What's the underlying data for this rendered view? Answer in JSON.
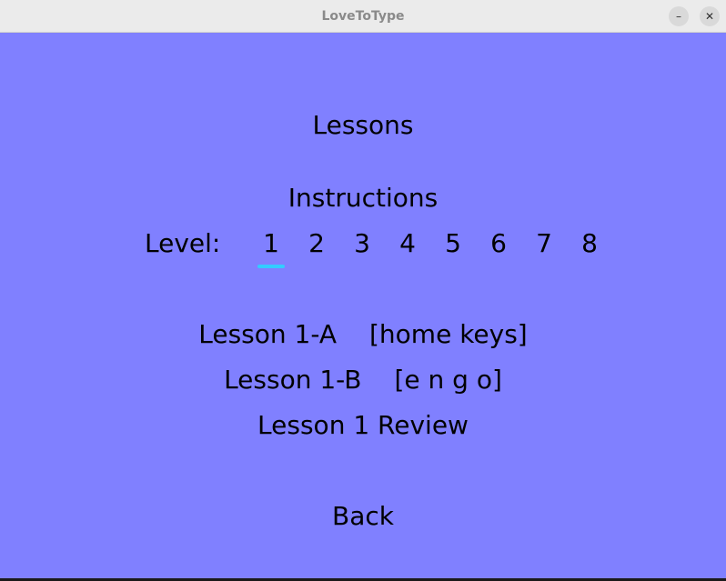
{
  "window": {
    "title": "LoveToType",
    "minimize_glyph": "–",
    "close_glyph": "✕"
  },
  "colors": {
    "background": "#8080ff",
    "selection_accent": "#33ccff"
  },
  "page": {
    "heading": "Lessons",
    "instructions": "Instructions",
    "level_label": "Level:",
    "levels": [
      "1",
      "2",
      "3",
      "4",
      "5",
      "6",
      "7",
      "8"
    ],
    "selected_level": "1",
    "lessons": [
      {
        "name": "Lesson 1-A",
        "keys": "[home keys]"
      },
      {
        "name": "Lesson 1-B",
        "keys": "[e n g o]"
      },
      {
        "name": "Lesson 1 Review",
        "keys": ""
      }
    ],
    "back_label": "Back"
  }
}
